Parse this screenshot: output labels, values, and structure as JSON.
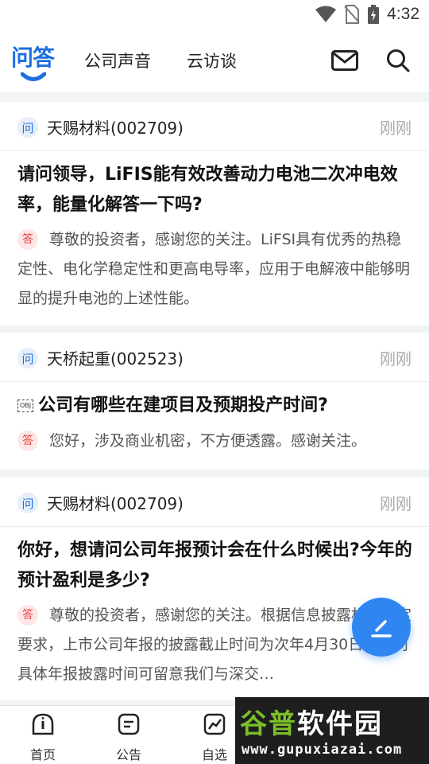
{
  "status": {
    "time": "4:32"
  },
  "header": {
    "logo_text": "问答",
    "tabs": [
      {
        "label": "公司声音"
      },
      {
        "label": "云访谈"
      }
    ]
  },
  "cards": [
    {
      "badge": "问",
      "company": "天赐材料(002709)",
      "time": "刚刚",
      "question": "请问领导，LiFIS能有效改善动力电池二次冲电效率，能量化解答一下吗?",
      "answer_badge": "答",
      "answer": "尊敬的投资者，感谢您的关注。LiFSI具有优秀的热稳定性、电化学稳定性和更高电导率，应用于电解液中能够明显的提升电池的上述性能。"
    },
    {
      "badge": "问",
      "company": "天桥起重(002523)",
      "time": "刚刚",
      "question_prefix": "OBJ",
      "question": "公司有哪些在建项目及预期投产时间?",
      "answer_badge": "答",
      "answer": "您好，涉及商业机密，不方便透露。感谢关注。"
    },
    {
      "badge": "问",
      "company": "天赐材料(002709)",
      "time": "刚刚",
      "question": "你好，想请问公司年报预计会在什么时候出?今年的预计盈利是多少?",
      "answer_badge": "答",
      "answer": "尊敬的投资者，感谢您的关注。根据信息披露相关规定要求，上市公司年报的披露截止时间为次年4月30日，公司具体年报披露时间可留意我们与深交…"
    }
  ],
  "tabbar": [
    {
      "label": "首页"
    },
    {
      "label": "公告"
    },
    {
      "label": "自选"
    }
  ],
  "watermark": {
    "title_part1": "谷普",
    "title_part2": "软件园",
    "url": "www.gupuxiazai.com"
  },
  "colors": {
    "brand": "#1d6fe0",
    "answer_badge": "#e84545",
    "fab": "#2f86f0"
  }
}
